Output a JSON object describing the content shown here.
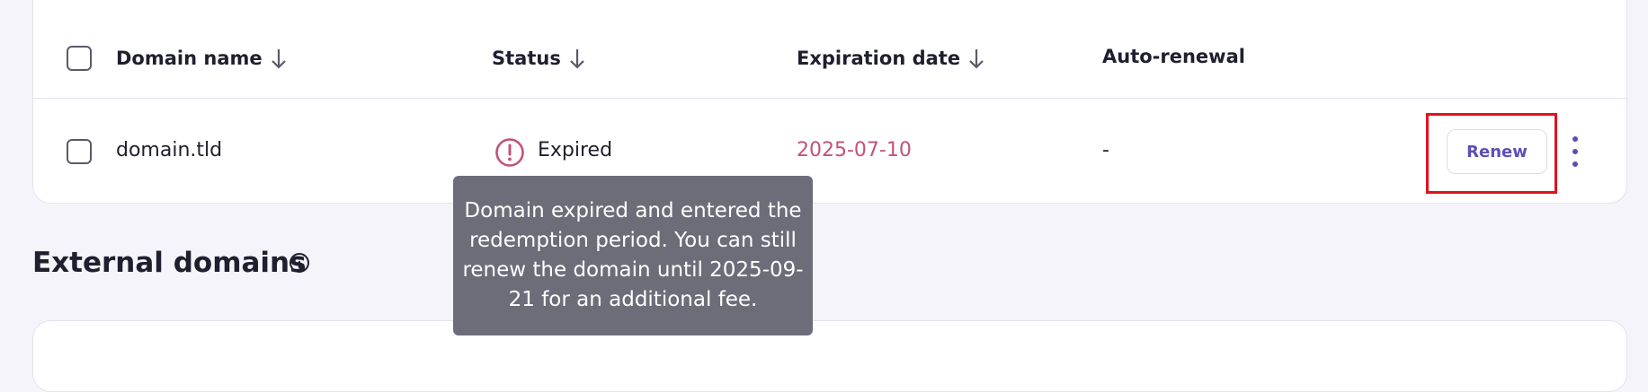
{
  "table": {
    "headers": {
      "domain_name": "Domain name",
      "status": "Status",
      "expiration_date": "Expiration date",
      "auto_renewal": "Auto-renewal"
    },
    "rows": [
      {
        "domain": "domain.tld",
        "status": "Expired",
        "expiration_date": "2025-07-10",
        "auto_renewal": "-",
        "action_label": "Renew"
      }
    ]
  },
  "tooltip": {
    "text": "Domain expired and entered the redemption period. You can still renew the domain until 2025-09-21 for an additional fee."
  },
  "external_domains": {
    "title": "External domains"
  },
  "icons": {
    "sort": "arrow-down-icon",
    "status": "exclamation-circle-icon",
    "info": "info-circle-icon",
    "more": "kebab-menu-icon"
  },
  "colors": {
    "accent": "#5b4fb5",
    "expired": "#c3527b",
    "highlight": "#e0121e",
    "tooltip_bg": "#6d6d7a"
  }
}
